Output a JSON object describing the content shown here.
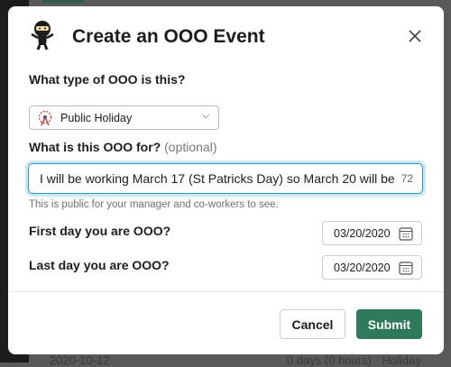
{
  "background": {
    "date_text": "2020-10-12",
    "summary_text": "0 days (0 hours) · Holiday"
  },
  "modal": {
    "title": "Create an OOO Event",
    "close_label": "×",
    "type_label": "What type of OOO is this?",
    "type_value": "Public Holiday",
    "reason_label": "What is this OOO for?",
    "reason_optional": "(optional)",
    "reason_value": "I will be working March 17 (St Patricks Day) so March 20 will be",
    "reason_remaining": "72",
    "help_text": "This is public for your manager and co-workers to see.",
    "first_day_label": "First day you are OOO?",
    "first_day_value": "03/20/2020",
    "last_day_label": "Last day you are OOO?",
    "last_day_value": "03/20/2020",
    "cancel_label": "Cancel",
    "submit_label": "Submit"
  },
  "colors": {
    "submit": "#2e7a5b",
    "focus": "#1d9bd1"
  }
}
